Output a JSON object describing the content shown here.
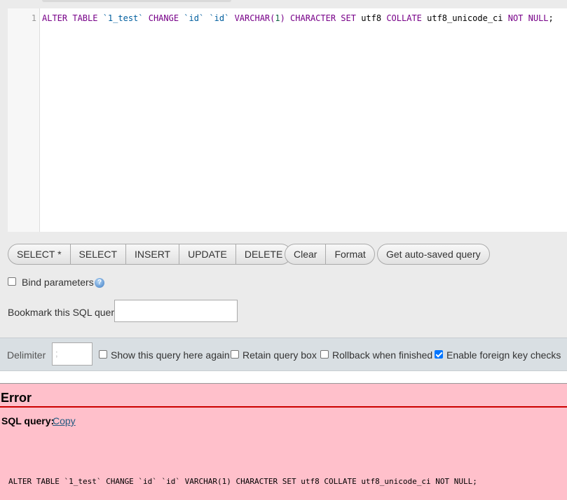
{
  "editor": {
    "line_number": "1",
    "tokens": [
      {
        "text": "ALTER TABLE ",
        "cls": "kw"
      },
      {
        "text": "`1_test`",
        "cls": "bt"
      },
      {
        "text": " CHANGE ",
        "cls": "kw"
      },
      {
        "text": "`id`",
        "cls": "bt"
      },
      {
        "text": " ",
        "cls": "plain"
      },
      {
        "text": "`id`",
        "cls": "bt"
      },
      {
        "text": " VARCHAR(",
        "cls": "kw"
      },
      {
        "text": "1",
        "cls": "num"
      },
      {
        "text": ") CHARACTER SET ",
        "cls": "kw"
      },
      {
        "text": "utf8 ",
        "cls": "plain"
      },
      {
        "text": "COLLATE ",
        "cls": "kw"
      },
      {
        "text": "utf8_unicode_ci ",
        "cls": "plain"
      },
      {
        "text": "NOT NULL",
        "cls": "kw"
      },
      {
        "text": ";",
        "cls": "plain"
      }
    ]
  },
  "buttons": {
    "select_star": "SELECT *",
    "select": "SELECT",
    "insert": "INSERT",
    "update": "UPDATE",
    "delete": "DELETE",
    "clear": "Clear",
    "format": "Format",
    "get_autosaved": "Get auto-saved query"
  },
  "bind_parameters": {
    "label": "Bind parameters",
    "checked": false
  },
  "bookmark": {
    "label": "Bookmark this SQL query:",
    "value": ""
  },
  "options": {
    "delimiter_label": "Delimiter",
    "delimiter_value": ";",
    "show_query_again": {
      "label": "Show this query here again",
      "checked": false
    },
    "retain_query_box": {
      "label": "Retain query box",
      "checked": false
    },
    "rollback": {
      "label": "Rollback when finished",
      "checked": false
    },
    "foreign_key": {
      "label": "Enable foreign key checks",
      "checked": true
    }
  },
  "error": {
    "title": "Error",
    "sql_label": "SQL query:",
    "copy_link": "Copy",
    "query_text": "ALTER TABLE `1_test` CHANGE `id` `id` VARCHAR(1) CHARACTER SET utf8 COLLATE utf8_unicode_ci NOT NULL;"
  }
}
